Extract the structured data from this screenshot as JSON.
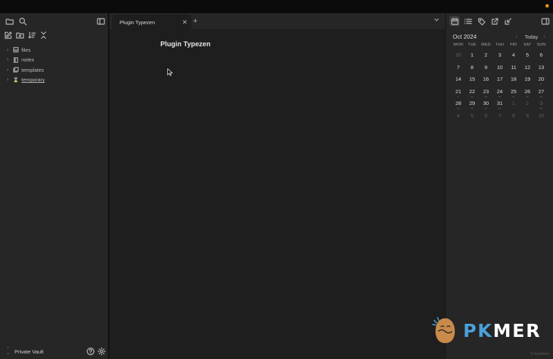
{
  "topbar": {
    "status_dot_color": "#e8951c"
  },
  "left_sidebar": {
    "icons": [
      "folder-icon",
      "search-icon",
      "sidebar-toggle-icon"
    ],
    "actions": [
      "new-note-icon",
      "new-folder-icon",
      "sort-icon",
      "collapse-icon"
    ],
    "tree": [
      {
        "name": "files",
        "icon": "image-icon"
      },
      {
        "name": "notes",
        "icon": "book-icon"
      },
      {
        "name": "templates",
        "icon": "copy-icon"
      },
      {
        "name": "temporary",
        "icon": "hourglass-icon"
      }
    ],
    "vault_name": "Private Vault"
  },
  "editor": {
    "tab_label": "Plugin Typezen",
    "note_title": "Plugin Typezen"
  },
  "calendar": {
    "month_label": "Oct 2024",
    "today_label": "Today",
    "dow": [
      "MON",
      "TUE",
      "WED",
      "THU",
      "FRI",
      "SAT",
      "SUN"
    ],
    "weeks": [
      [
        {
          "d": "30",
          "m": true,
          "dots": ""
        },
        {
          "d": "1",
          "dots": ""
        },
        {
          "d": "2",
          "dots": ""
        },
        {
          "d": "3",
          "dots": ""
        },
        {
          "d": "4",
          "dots": ""
        },
        {
          "d": "5",
          "dots": ""
        },
        {
          "d": "6",
          "dots": ""
        }
      ],
      [
        {
          "d": "7",
          "dots": ""
        },
        {
          "d": "8",
          "dots": ""
        },
        {
          "d": "9",
          "dots": ""
        },
        {
          "d": "10",
          "dots": ""
        },
        {
          "d": "11",
          "dots": ""
        },
        {
          "d": "12",
          "dots": ""
        },
        {
          "d": "13",
          "dots": ""
        }
      ],
      [
        {
          "d": "14",
          "dots": ""
        },
        {
          "d": "15",
          "dots": ""
        },
        {
          "d": "16",
          "dots": ""
        },
        {
          "d": "17",
          "dots": ""
        },
        {
          "d": "18",
          "dots": ""
        },
        {
          "d": "19",
          "dots": ""
        },
        {
          "d": "20",
          "dots": "•"
        }
      ],
      [
        {
          "d": "21",
          "dots": "•"
        },
        {
          "d": "22",
          "dots": "••"
        },
        {
          "d": "23",
          "dots": "••"
        },
        {
          "d": "24",
          "dots": "••"
        },
        {
          "d": "25",
          "dots": "••"
        },
        {
          "d": "26",
          "dots": "••"
        },
        {
          "d": "27",
          "dots": "••"
        }
      ],
      [
        {
          "d": "28",
          "dots": "••"
        },
        {
          "d": "29",
          "dots": "••"
        },
        {
          "d": "30",
          "dots": "••"
        },
        {
          "d": "31",
          "dots": "••"
        },
        {
          "d": "1",
          "m": true,
          "dots": ""
        },
        {
          "d": "2",
          "m": true,
          "dots": ""
        },
        {
          "d": "3",
          "m": true,
          "dots": "••"
        }
      ],
      [
        {
          "d": "4",
          "m": true,
          "dots": ""
        },
        {
          "d": "5",
          "m": true,
          "dots": ""
        },
        {
          "d": "6",
          "m": true,
          "dots": ""
        },
        {
          "d": "7",
          "m": true,
          "dots": ""
        },
        {
          "d": "8",
          "m": true,
          "dots": ""
        },
        {
          "d": "9",
          "m": true,
          "dots": ""
        },
        {
          "d": "10",
          "m": true,
          "dots": ""
        }
      ]
    ],
    "backlinks": "0 backlinks"
  },
  "watermark": {
    "text_left": "PK",
    "text_right": "MER"
  }
}
